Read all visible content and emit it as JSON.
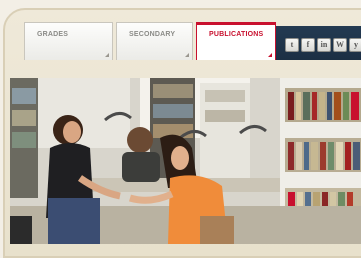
{
  "tabs": [
    {
      "label": "GRADES"
    },
    {
      "label": "SECONDARY"
    },
    {
      "label": "PUBLICATIONS"
    }
  ],
  "active_tab": "PUBLICATIONS",
  "social": [
    {
      "icon": "twitter-icon",
      "glyph": "t"
    },
    {
      "icon": "facebook-icon",
      "glyph": "f"
    },
    {
      "icon": "linkedin-icon",
      "glyph": "in"
    },
    {
      "icon": "wikipedia-icon",
      "glyph": "W"
    },
    {
      "icon": "more-icon",
      "glyph": "y"
    }
  ],
  "colors": {
    "accent": "#c8102e",
    "header_band": "#233a52",
    "shell": "#efe9d9"
  },
  "photo": {
    "subject": "library-students-photo"
  }
}
